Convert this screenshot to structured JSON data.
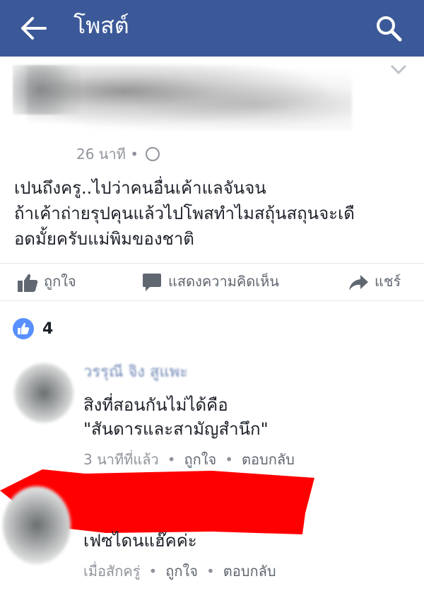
{
  "header": {
    "title": "โพสต์",
    "back_icon": "arrow-left-icon",
    "search_icon": "search-icon",
    "color": "#3b5998"
  },
  "post": {
    "time": "26 นาที •",
    "text_lines": [
      "เปนถึงครู..ไปว่าคนอื่นเค้าแลจันจน",
      "ถ้าเค้าถ่ายรุปคุนแล้วไปโพสทำไมสถุ้นสถุนจะเดื",
      "อดมั้ยครับแม่พิมของชาติ"
    ],
    "actions": {
      "like": "ถูกใจ",
      "comment": "แสดงความคิดเห็น",
      "share": "แชร์"
    }
  },
  "reactions": {
    "count": "4"
  },
  "comments": [
    {
      "name": "วรรุณี จิง สูแพะ",
      "text_lines": [
        "สิงที่สอนกันไม่ได้คือ",
        "\"สันดารและสามัญสำนึก\""
      ],
      "time": "3 นาทีที่แล้ว",
      "like": "ถูกใจ",
      "reply": "ตอบกลับ"
    },
    {
      "text_lines": [
        "เฟซไดนแฮ๊คค่ะ"
      ],
      "time": "เมื่อสักครู่",
      "like": "ถูกใจ",
      "reply": "ตอบกลับ"
    }
  ],
  "colors": {
    "redaction": "#ff0000",
    "link": "#365899",
    "meta": "#90949c"
  }
}
